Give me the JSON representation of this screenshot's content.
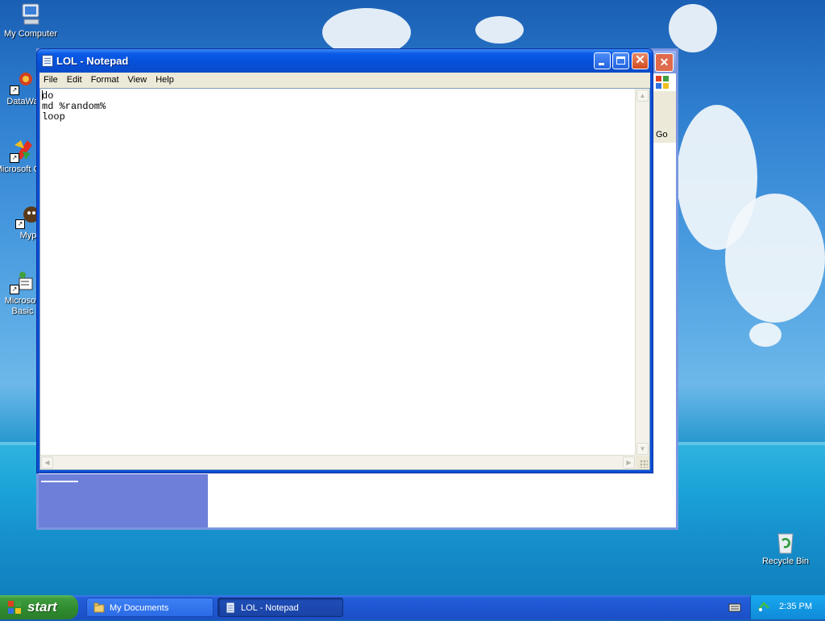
{
  "desktop": {
    "icons": [
      {
        "label": "My Computer"
      },
      {
        "label": "DataWa"
      },
      {
        "label": "Microsoft C++"
      },
      {
        "label": "Myp"
      },
      {
        "label": "Microsoft Basic"
      },
      {
        "label": "Recycle Bin"
      }
    ]
  },
  "background_window": {
    "go_label": "Go",
    "close_glyph": "✕"
  },
  "notepad": {
    "title": "LOL - Notepad",
    "menu": [
      "File",
      "Edit",
      "Format",
      "View",
      "Help"
    ],
    "content": "do\nmd %random%\nloop",
    "close_glyph": "✕"
  },
  "taskbar": {
    "start_label": "start",
    "tasks": [
      {
        "label": "My Documents",
        "active": false
      },
      {
        "label": "LOL - Notepad",
        "active": true
      }
    ],
    "clock": "2:35 PM"
  },
  "colors": {
    "titlebar": "#0a5ae8",
    "taskbar": "#245edb",
    "start_button": "#3d9c3d",
    "tray": "#0f8ad8"
  },
  "icons": {
    "notepad": "notepad-icon",
    "folder": "folder-icon",
    "recycle": "recycle-bin-icon",
    "computer": "my-computer-icon"
  }
}
